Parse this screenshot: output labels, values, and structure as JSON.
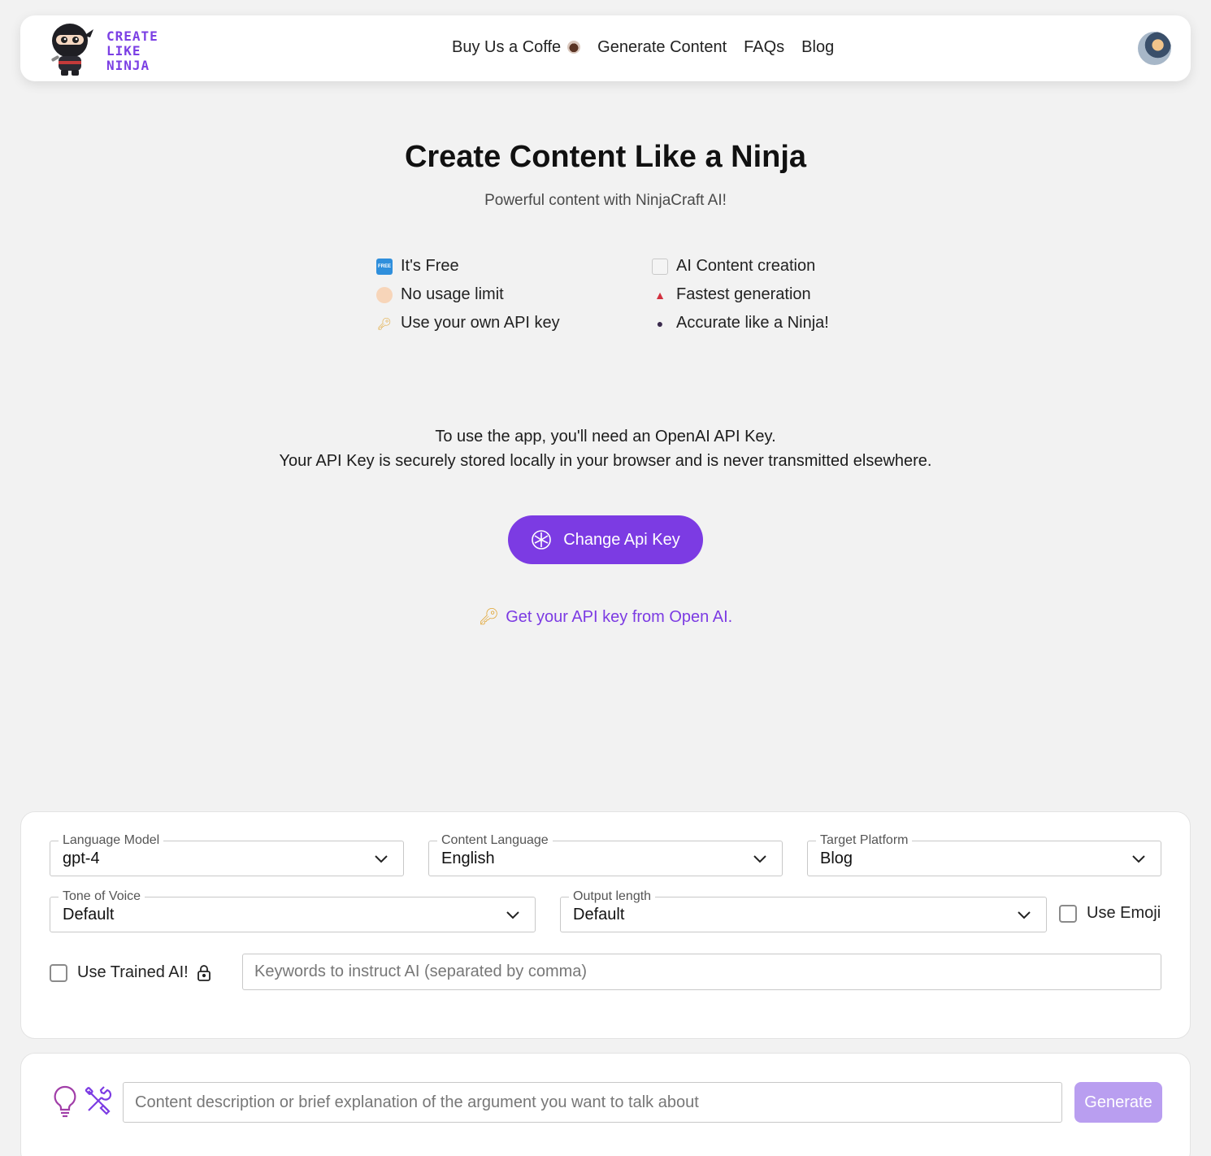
{
  "header": {
    "logo_text": [
      "CREATE",
      "LIKE",
      "NINJA"
    ],
    "nav": {
      "coffee": "Buy Us a Coffe",
      "generate": "Generate Content",
      "faqs": "FAQs",
      "blog": "Blog"
    }
  },
  "hero": {
    "title": "Create Content Like a Ninja",
    "subtitle": "Powerful content with NinjaCraft AI!"
  },
  "features": {
    "free": "It's Free",
    "limit": "No usage limit",
    "own_key": "Use your own API key",
    "ai": "AI Content creation",
    "fast": "Fastest generation",
    "accurate": "Accurate like a Ninja!",
    "free_badge": "FREE"
  },
  "info": {
    "line1": "To use the app, you'll need an OpenAI API Key.",
    "line2": "Your API Key is securely stored locally in your browser and is never transmitted elsewhere."
  },
  "api_button": "Change Api Key",
  "get_key_link": "Get your API key from Open AI.",
  "settings": {
    "language_model": {
      "label": "Language Model",
      "value": "gpt-4"
    },
    "content_language": {
      "label": "Content Language",
      "value": "English"
    },
    "target_platform": {
      "label": "Target Platform",
      "value": "Blog"
    },
    "tone": {
      "label": "Tone of Voice",
      "value": "Default"
    },
    "output_length": {
      "label": "Output length",
      "value": "Default"
    },
    "use_emoji": "Use Emoji",
    "use_trained": "Use Trained AI!",
    "keywords_placeholder": "Keywords to instruct AI (separated by comma)"
  },
  "generator": {
    "description_placeholder": "Content description or brief explanation of the argument you want to talk about",
    "generate_label": "Generate"
  },
  "colors": {
    "accent": "#7c3be3",
    "accent_light": "#b99ef0",
    "background": "#f2f2f2"
  }
}
